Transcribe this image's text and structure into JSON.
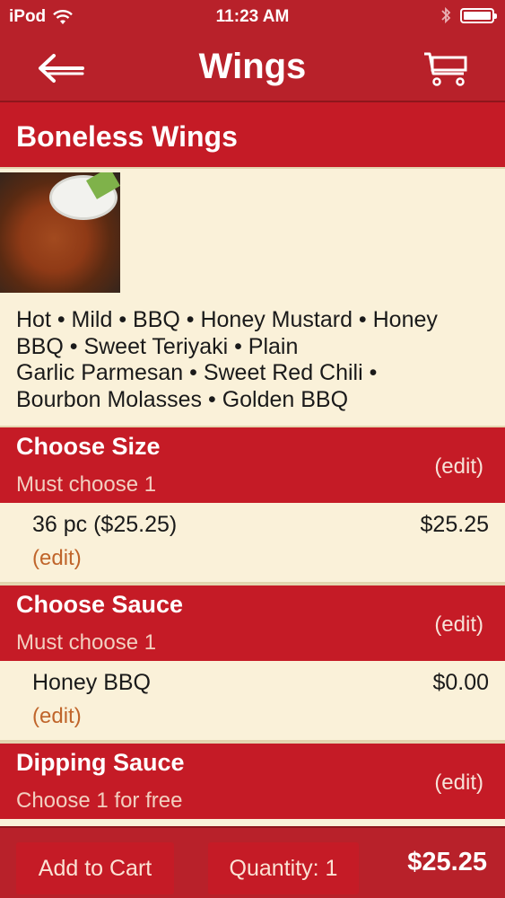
{
  "status_bar": {
    "carrier": "iPod",
    "time": "11:23 AM"
  },
  "nav": {
    "title": "Wings",
    "back_icon": "left-arrow-icon",
    "cart_icon": "shopping-cart-icon"
  },
  "item": {
    "name": "Boneless Wings",
    "description_lines": [
      "Hot • Mild • BBQ • Honey Mustard • Honey",
      "BBQ • Sweet Teriyaki • Plain",
      "Garlic Parmesan • Sweet Red Chili •",
      "Bourbon Molasses • Golden BBQ"
    ]
  },
  "sections": [
    {
      "title": "Choose Size",
      "subtitle": "Must choose 1",
      "edit_label": "(edit)",
      "selection": {
        "name": "36 pc ($25.25)",
        "price": "$25.25",
        "edit_label": "(edit)"
      }
    },
    {
      "title": "Choose Sauce",
      "subtitle": "Must choose 1",
      "edit_label": "(edit)",
      "selection": {
        "name": "Honey BBQ",
        "price": "$0.00",
        "edit_label": "(edit)"
      }
    },
    {
      "title": "Dipping Sauce",
      "subtitle": "Choose 1 for free",
      "edit_label": "(edit)"
    }
  ],
  "footer": {
    "add_to_cart_label": "Add to Cart",
    "quantity_label": "Quantity: 1",
    "total": "$25.25"
  },
  "colors": {
    "header_red": "#b8212a",
    "section_red": "#c51b26",
    "cream": "#faf1d9",
    "edit_orange": "#c0652b"
  }
}
